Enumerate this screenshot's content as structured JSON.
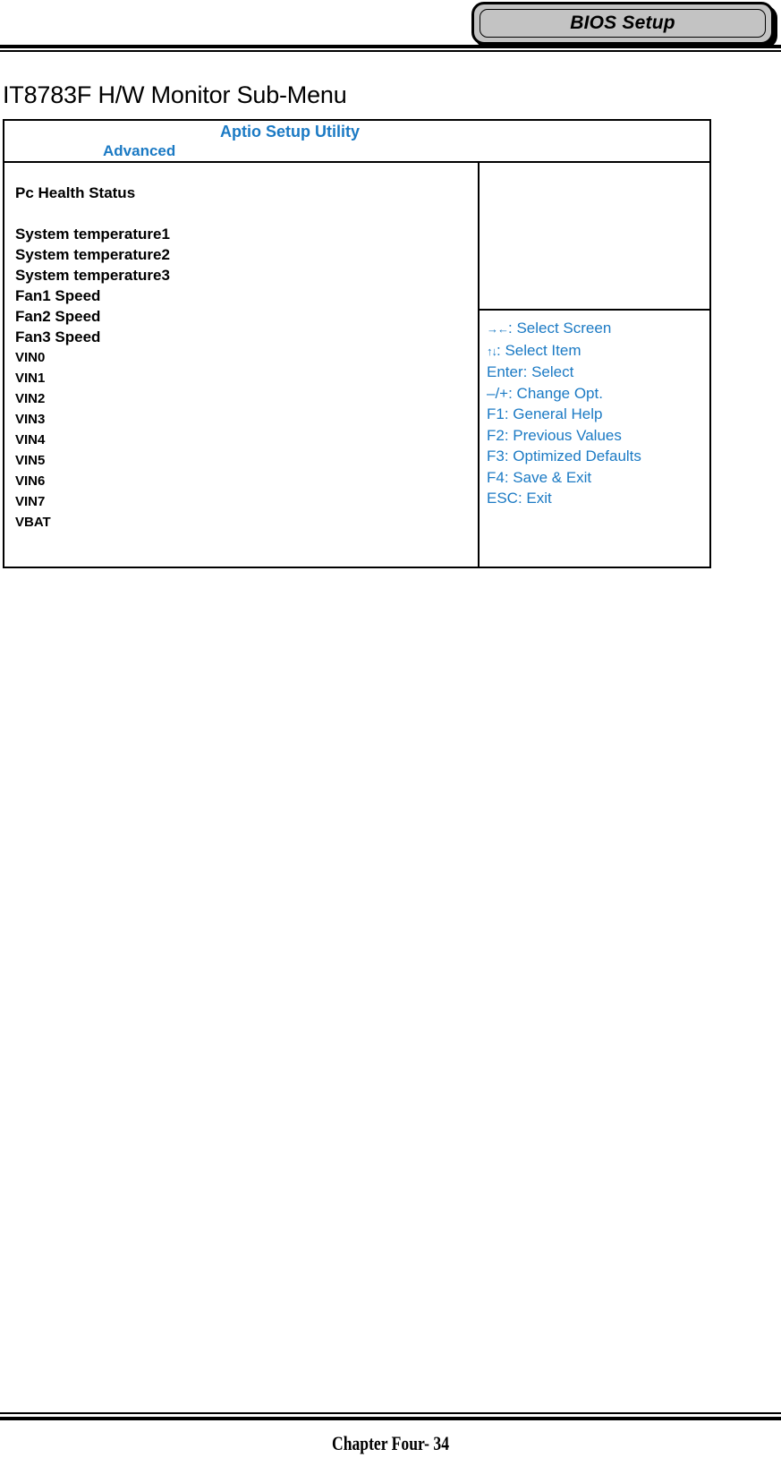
{
  "header": {
    "tab_label": "BIOS Setup"
  },
  "page_title": "IT8783F H/W Monitor Sub-Menu",
  "bios_screen": {
    "utility_title": "Aptio Setup Utility",
    "active_tab": "Advanced",
    "section_heading": "Pc Health Status",
    "items": [
      "System temperature1",
      "System temperature2",
      "System temperature3",
      "Fan1 Speed",
      "Fan2 Speed",
      "Fan3 Speed"
    ],
    "voltage_items": [
      "VIN0",
      "VIN1",
      "VIN2",
      "VIN3",
      "VIN4",
      "VIN5",
      "VIN6",
      "VIN7",
      "VBAT"
    ],
    "help": {
      "lines": [
        {
          "keys": "→←",
          "text": ": Select Screen"
        },
        {
          "keys": "↑↓",
          "text": ": Select Item"
        },
        {
          "keys": "",
          "text": "Enter: Select"
        },
        {
          "keys": "",
          "text": "–/+: Change Opt."
        },
        {
          "keys": "",
          "text": "F1: General Help"
        },
        {
          "keys": "",
          "text": "F2: Previous Values"
        },
        {
          "keys": "",
          "text": "F3: Optimized Defaults"
        },
        {
          "keys": "",
          "text": "F4: Save & Exit"
        },
        {
          "keys": "",
          "text": "ESC: Exit"
        }
      ]
    }
  },
  "footer": {
    "text": "Chapter Four- 34"
  },
  "colors": {
    "accent_blue": "#1b7ac4",
    "tab_gray": "#c3c3c3",
    "ink": "#000000"
  }
}
